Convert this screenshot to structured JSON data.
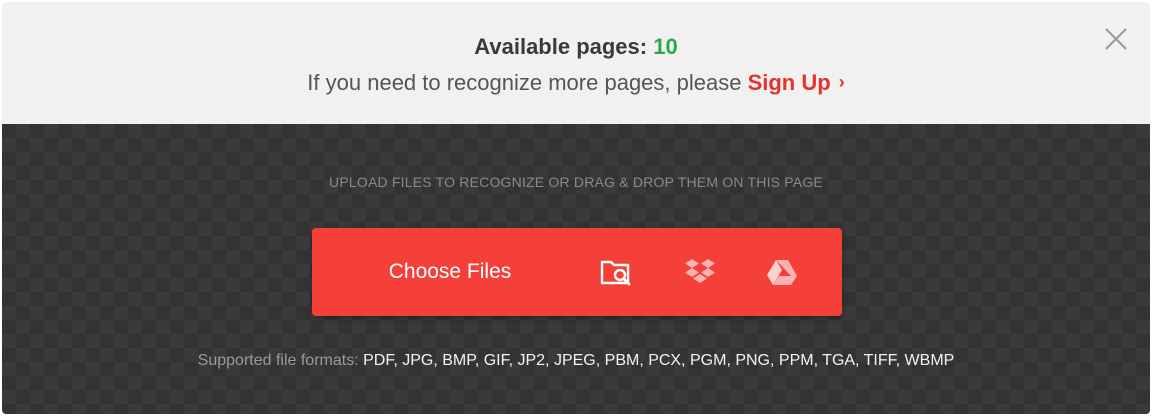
{
  "banner": {
    "available_label": "Available pages: ",
    "available_count": "10",
    "message": "If you need to recognize more pages, please ",
    "signup_label": "Sign Up",
    "chevron": "›"
  },
  "close": {
    "icon": "close-icon"
  },
  "upload": {
    "hint": "UPLOAD FILES TO RECOGNIZE OR DRAG & DROP THEM ON THIS PAGE",
    "choose_files_label": "Choose Files",
    "sources": [
      {
        "icon": "folder-search-icon"
      },
      {
        "icon": "dropbox-icon"
      },
      {
        "icon": "google-drive-icon"
      }
    ]
  },
  "formats": {
    "label": "Supported file formats: ",
    "list": "PDF, JPG, BMP, GIF, JP2, JPEG, PBM, PCX, PGM, PNG, PPM, TGA, TIFF, WBMP"
  },
  "colors": {
    "accent": "#f5403a",
    "count_green": "#2aa84a",
    "banner_bg": "#f1f1f1",
    "dropzone_bg": "#333333"
  }
}
